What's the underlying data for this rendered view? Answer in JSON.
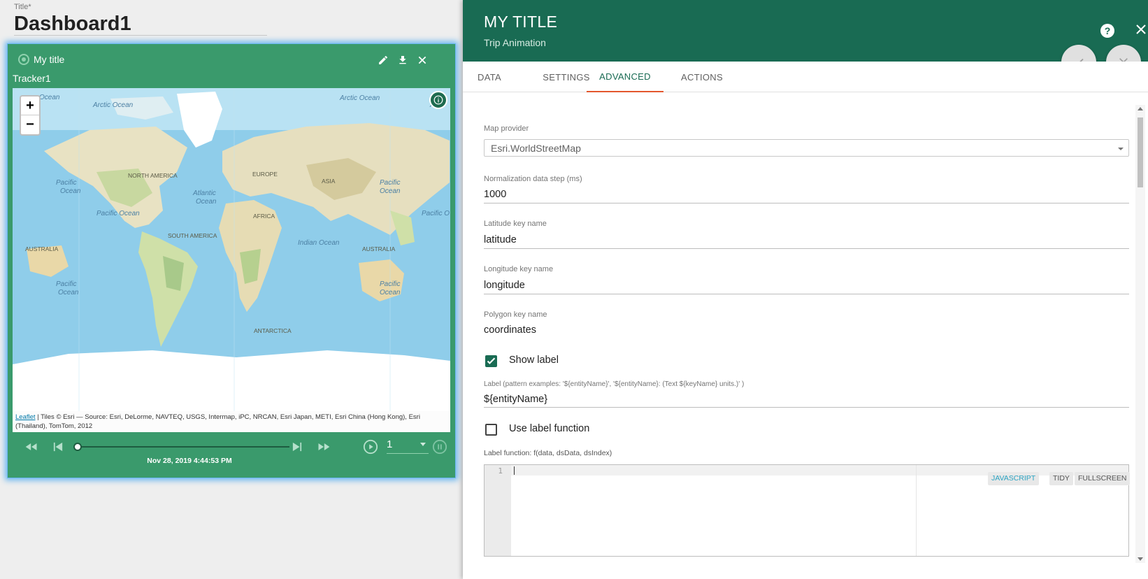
{
  "dashboard": {
    "title_label": "Title",
    "title_required_mark": "*",
    "title_value": "Dashboard1"
  },
  "widget": {
    "title": "My title",
    "subtitle": "Tracker1",
    "map": {
      "labels": {
        "ocean_tl": "Ocean",
        "arctic_ocean_1": "Arctic Ocean",
        "arctic_ocean_2": "Arctic Ocean",
        "arctic_tr": "Arc",
        "north_america": "NORTH AMERICA",
        "europe": "EUROPE",
        "asia": "ASIA",
        "pacific_ocean_l_1": "Pacific",
        "pacific_ocean_l_2": "Ocean",
        "atlantic_1": "Atlantic",
        "atlantic_2": "Ocean",
        "pacific_ocean_r_1": "Pacific",
        "pacific_ocean_r_2": "Ocean",
        "pacific_ocean_mid": "Pacific Ocean",
        "pacific_ocean_far": "Pacific O",
        "africa": "AFRICA",
        "south_america": "SOUTH AMERICA",
        "australia_l": "AUSTRALIA",
        "australia_r": "AUSTRALIA",
        "indian_ocean": "Indian Ocean",
        "pacific_bl_1": "Pacific",
        "pacific_bl_2": "Ocean",
        "pacific_br_1": "Pacific",
        "pacific_br_2": "Ocean",
        "antarctica": "ANTARCTICA"
      },
      "zoom_in": "+",
      "zoom_out": "−",
      "attribution_link": "Leaflet",
      "attribution_text": " | Tiles © Esri — Source: Esri, DeLorme, NAVTEQ, USGS, Intermap, iPC, NRCAN, Esri Japan, METI, Esri China (Hong Kong), Esri (Thailand), TomTom, 2012"
    },
    "player": {
      "timestamp": "Nov 28, 2019 4:44:53 PM",
      "speed": "1",
      "progress_fraction": 0
    }
  },
  "panel": {
    "title": "MY TITLE",
    "subtitle": "Trip Animation",
    "tabs": [
      {
        "label": "DATA"
      },
      {
        "label": "SETTINGS"
      },
      {
        "label": "ADVANCED"
      },
      {
        "label": "ACTIONS"
      }
    ],
    "active_tab": "ADVANCED",
    "fields": {
      "map_provider_label": "Map provider",
      "map_provider_value": "Esri.WorldStreetMap",
      "norm_label": "Normalization data step (ms)",
      "norm_value": "1000",
      "lat_label": "Latitude key name",
      "lat_value": "latitude",
      "lon_label": "Longitude key name",
      "lon_value": "longitude",
      "poly_label": "Polygon key name",
      "poly_value": "coordinates",
      "show_label": "Show label",
      "show_label_checked": true,
      "label_pattern_label": "Label (pattern examples: '${entityName}', '${entityName}: (Text ${keyName} units.)' )",
      "label_pattern_value": "${entityName}",
      "use_label_fn": "Use label function",
      "use_label_fn_checked": false,
      "label_fn_label": "Label function: f(data, dsData, dsIndex)"
    },
    "editor": {
      "line_number": "1",
      "btn_javascript": "JAVASCRIPT",
      "btn_tidy": "TIDY",
      "btn_fullscreen": "FULLSCREEN"
    }
  },
  "colors": {
    "header": "#196b53",
    "widget_bg": "#3a9a6c",
    "tab_indicator": "#e4572e"
  }
}
